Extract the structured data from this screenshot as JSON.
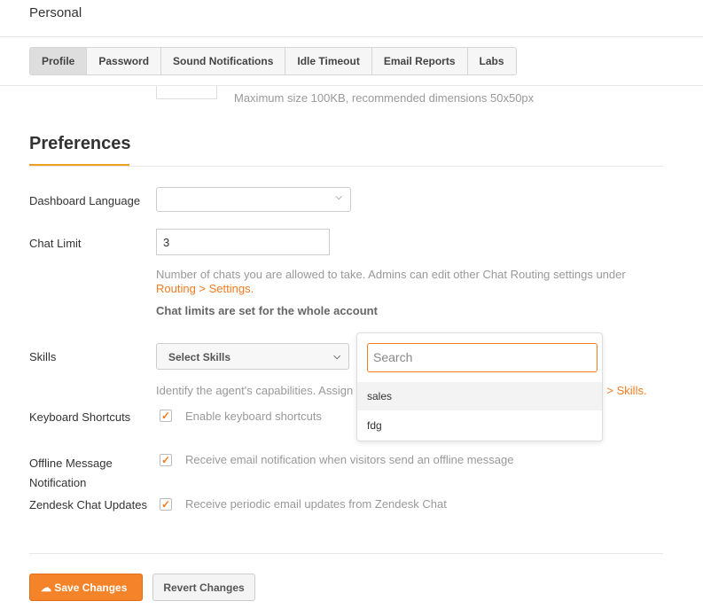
{
  "header": {
    "title": "Personal"
  },
  "tabs": [
    "Profile",
    "Password",
    "Sound Notifications",
    "Idle Timeout",
    "Email Reports",
    "Labs"
  ],
  "avatar_hint": "Maximum size 100KB, recommended dimensions 50x50px",
  "preferences": {
    "heading": "Preferences",
    "dashboard_language": {
      "label": "Dashboard Language",
      "value": ""
    },
    "chat_limit": {
      "label": "Chat Limit",
      "value": "3",
      "help": "Number of chats you are allowed to take. Admins can edit other Chat Routing settings under",
      "help_link": "Routing > Settings.",
      "note": "Chat limits are set for the whole account"
    },
    "skills": {
      "label": "Skills",
      "select_label": "Select Skills",
      "help": "Identify the agent's capabilities. Assign",
      "help_link": "Routing > Skills.",
      "dropdown": {
        "search_placeholder": "Search",
        "options": [
          "sales",
          "fdg"
        ]
      }
    },
    "keyboard": {
      "label": "Keyboard Shortcuts",
      "checkbox": "Enable keyboard shortcuts",
      "checked": true
    },
    "offline": {
      "label_1": "Offline Message",
      "label_2": "Notification",
      "checkbox": "Receive email notification when visitors send an offline message",
      "checked": true
    },
    "updates": {
      "label": "Zendesk Chat Updates",
      "checkbox": "Receive periodic email updates from Zendesk Chat",
      "checked": true
    }
  },
  "actions": {
    "save": "Save Changes",
    "revert": "Revert Changes"
  },
  "colors": {
    "accent": "#f47b20"
  }
}
